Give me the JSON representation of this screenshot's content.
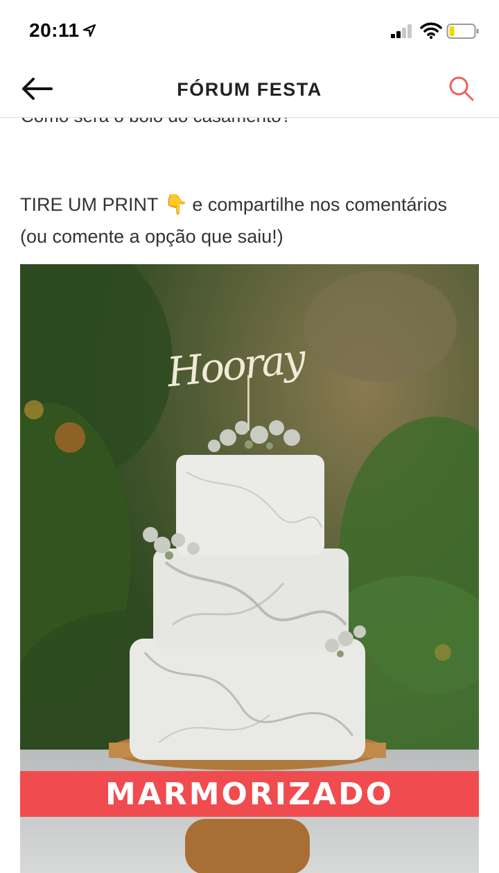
{
  "status_bar": {
    "time": "20:11"
  },
  "nav": {
    "title": "FÓRUM FESTA",
    "accent_color": "#f0605f"
  },
  "post": {
    "cut_line": "Como será o bolo do casamento?",
    "text_part1": "TIRE UM PRINT",
    "emoji_icon": "point-down-icon",
    "emoji": "👇",
    "text_part2": "e compartilhe nos comentários (ou comente a opção que saiu!)",
    "image": {
      "topper_text": "Hooray",
      "banner_label": "MARMORIZADO",
      "banner_color": "#f04b4f"
    }
  }
}
